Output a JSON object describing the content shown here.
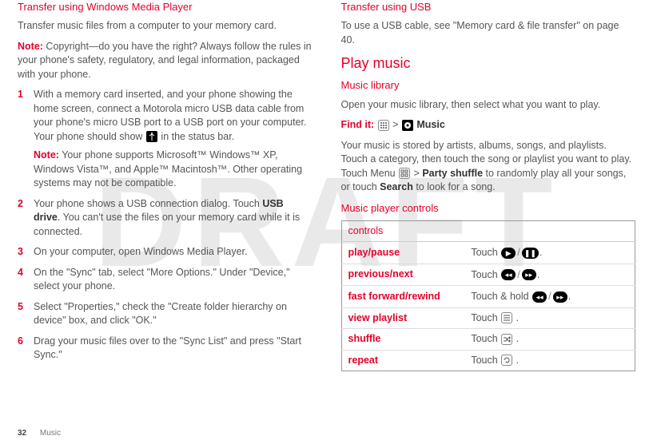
{
  "watermark": "DRAFT",
  "left": {
    "heading": "Transfer using Windows Media Player",
    "intro": "Transfer music files from a computer to your memory card.",
    "note_label": "Note:",
    "note_text": " Copyright—do you have the right? Always follow the rules in your phone's safety, regulatory, and legal information, packaged with your phone.",
    "steps": [
      {
        "n": "1",
        "text_a": "With a memory card inserted, and your phone showing the home screen, connect a Motorola micro USB data cable from your phone's micro USB port to a USB port on your computer. Your phone should show ",
        "text_b": " in the status bar.",
        "sub_note_label": "Note:",
        "sub_note_text": " Your phone supports Microsoft™ Windows™ XP, Windows Vista™, and Apple™ Macintosh™. Other operating systems may not be compatible."
      },
      {
        "n": "2",
        "text_a": "Your phone shows a USB connection dialog. Touch ",
        "bold": "USB drive",
        "text_b": ". You can't use the files on your memory card while it is connected."
      },
      {
        "n": "3",
        "text_a": "On your computer, open Windows Media Player."
      },
      {
        "n": "4",
        "text_a": "On the \"Sync\" tab, select \"More Options.\" Under \"Device,\" select your phone."
      },
      {
        "n": "5",
        "text_a": "Select \"Properties,\" check the \"Create folder hierarchy on device\" box, and click \"OK.\""
      },
      {
        "n": "6",
        "text_a": "Drag your music files over to the \"Sync List\" and press \"Start Sync.\""
      }
    ]
  },
  "right": {
    "usb_heading": "Transfer using USB",
    "usb_text": "To use a USB cable, see \"Memory card & file transfer\" on page 40.",
    "play_heading": "Play music",
    "library_heading": "Music library",
    "library_text": "Open your music library, then select what you want to play.",
    "findit_label": "Find it:",
    "findit_music": "Music",
    "storage_a": "Your music is stored by artists, albums, songs, and playlists. Touch a category, then touch the song or playlist you want to play. Touch Menu ",
    "storage_b": " > ",
    "storage_bold1": "Party shuffle",
    "storage_c": " to randomly play all your songs, or touch ",
    "storage_bold2": "Search",
    "storage_d": " to look for a song.",
    "controls_heading": "Music player controls",
    "table": {
      "header": "controls",
      "rows": [
        {
          "name": "play/pause",
          "action": "Touch "
        },
        {
          "name": "previous/next",
          "action": "Touch "
        },
        {
          "name": "fast forward/rewind",
          "action": "Touch & hold "
        },
        {
          "name": "view playlist",
          "action": "Touch "
        },
        {
          "name": "shuffle",
          "action": "Touch "
        },
        {
          "name": "repeat",
          "action": "Touch "
        }
      ]
    }
  },
  "footer": {
    "page": "32",
    "section": "Music"
  }
}
